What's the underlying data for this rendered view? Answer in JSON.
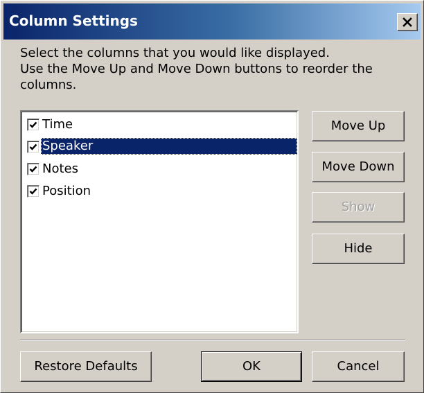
{
  "window": {
    "title": "Column Settings"
  },
  "instructions": {
    "line1": "Select the columns that you would like displayed.",
    "line2": "Use the Move Up and Move Down buttons to reorder the",
    "line3": "columns."
  },
  "columns": [
    {
      "label": "Time",
      "checked": true,
      "selected": false
    },
    {
      "label": "Speaker",
      "checked": true,
      "selected": true
    },
    {
      "label": "Notes",
      "checked": true,
      "selected": false
    },
    {
      "label": "Position",
      "checked": true,
      "selected": false
    }
  ],
  "side_buttons": {
    "move_up": "Move Up",
    "move_down": "Move Down",
    "show": "Show",
    "hide": "Hide"
  },
  "bottom_buttons": {
    "restore_defaults": "Restore Defaults",
    "ok": "OK",
    "cancel": "Cancel"
  },
  "colors": {
    "title_gradient_start": "#0a246a",
    "title_gradient_end": "#a6caf0",
    "selection": "#0a246a",
    "face": "#d4d0c8"
  }
}
